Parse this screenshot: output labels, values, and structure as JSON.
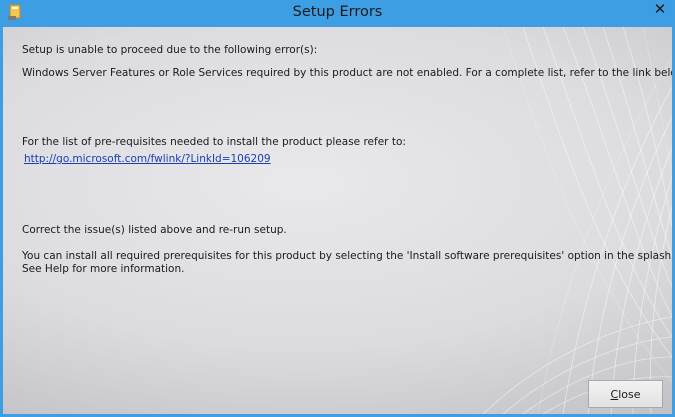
{
  "window": {
    "title": "Setup Errors",
    "close_glyph": "✕"
  },
  "body": {
    "line1": "Setup is unable to proceed due to the following error(s):",
    "line2": "Windows Server Features or Role Services required by this product are not enabled. For a complete list, refer to the link below.",
    "line3": "For the list of pre-requisites needed to install the product please refer to:",
    "link": "http://go.microsoft.com/fwlink/?LinkId=106209",
    "line4": "Correct the issue(s) listed above and re-run setup.",
    "line5": "You can install all required prerequisites for this product by selecting the 'Install software prerequisites' option in the splash screen.",
    "line6": "See Help for more information."
  },
  "buttons": {
    "close_mnemonic": "C",
    "close_rest": "lose"
  },
  "colors": {
    "titlebar": "#3d9ee4",
    "link": "#1a3fb0"
  }
}
